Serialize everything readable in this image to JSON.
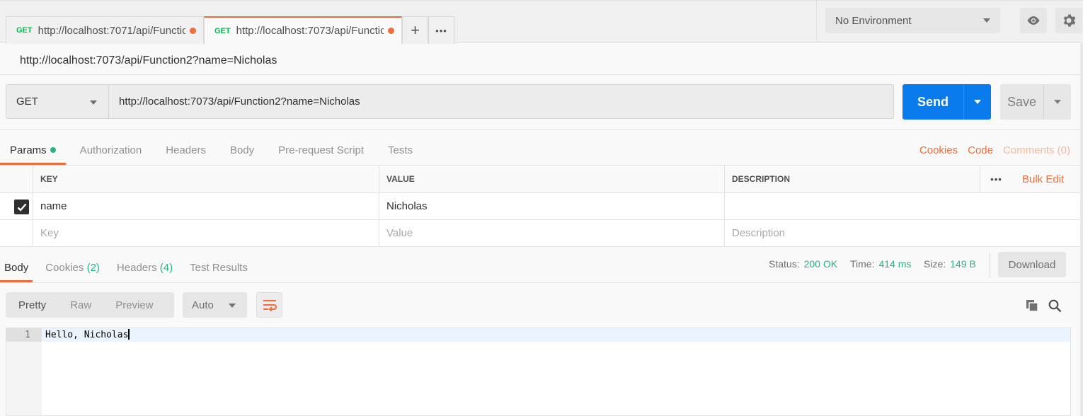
{
  "tabs": [
    {
      "method": "GET",
      "url": "http://localhost:7071/api/Functio",
      "active": false
    },
    {
      "method": "GET",
      "url": "http://localhost:7073/api/Functio",
      "active": true
    }
  ],
  "tab_actions": {
    "add": "+",
    "more": "•••"
  },
  "environment": {
    "selected": "No Environment"
  },
  "request": {
    "title": "http://localhost:7073/api/Function2?name=Nicholas",
    "method": "GET",
    "url": "http://localhost:7073/api/Function2?name=Nicholas",
    "send_label": "Send",
    "save_label": "Save"
  },
  "request_tabs": [
    "Params",
    "Authorization",
    "Headers",
    "Body",
    "Pre-request Script",
    "Tests"
  ],
  "request_links": {
    "cookies": "Cookies",
    "code": "Code",
    "comments": "Comments (0)"
  },
  "params": {
    "headers": [
      "KEY",
      "VALUE",
      "DESCRIPTION"
    ],
    "more": "•••",
    "bulk_edit": "Bulk Edit",
    "rows": [
      {
        "key": "name",
        "value": "Nicholas",
        "description": "",
        "checked": true
      }
    ],
    "placeholders": {
      "key": "Key",
      "value": "Value",
      "description": "Description"
    }
  },
  "response_tabs": {
    "body": "Body",
    "cookies": "Cookies",
    "cookies_count": "(2)",
    "headers": "Headers",
    "headers_count": "(4)",
    "test_results": "Test Results"
  },
  "response_status": {
    "status_label": "Status:",
    "status": "200 OK",
    "time_label": "Time:",
    "time": "414 ms",
    "size_label": "Size:",
    "size": "149 B",
    "download": "Download"
  },
  "view_modes": [
    "Pretty",
    "Raw",
    "Preview"
  ],
  "format": "Auto",
  "body_lines": [
    {
      "no": "1",
      "text": "Hello, Nicholas"
    }
  ]
}
